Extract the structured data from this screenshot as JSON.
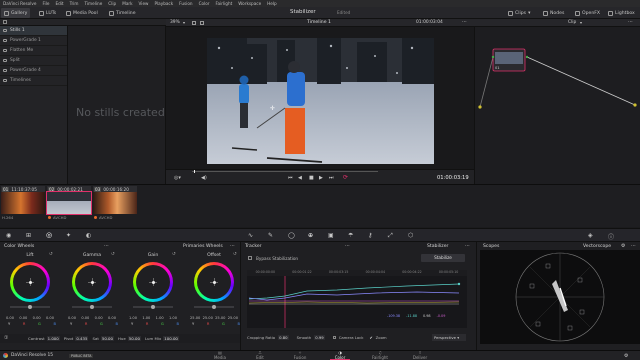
{
  "menu": {
    "items": [
      "DaVinci Resolve",
      "File",
      "Edit",
      "Trim",
      "Timeline",
      "Clip",
      "Mark",
      "View",
      "Playback",
      "Fusion",
      "Color",
      "Fairlight",
      "Workspace",
      "Help"
    ]
  },
  "toolbar": {
    "gallery": "Gallery",
    "luts": "LUTs",
    "media_pool": "Media Pool",
    "timeline": "Timeline",
    "project_title": "Stabilizer",
    "project_status": "Edited",
    "clips": "Clips",
    "nodes": "Nodes",
    "openfx": "OpenFX",
    "lightbox": "Lightbox"
  },
  "gallery": {
    "items": [
      "Stills 1",
      "PowerGrade 1",
      "Flatten Me",
      "Split",
      "PowerGrade 4",
      "Timelines"
    ],
    "empty_text": "No stills created"
  },
  "viewer": {
    "zoom": "39%",
    "timeline_name": "Timeline 1",
    "timecode_top": "01:00:03:04",
    "timecode": "01:00:03:19"
  },
  "node_panel": {
    "mode": "Clip",
    "node_label": "01"
  },
  "clips": [
    {
      "num": "01",
      "tc": "11:10:37:05",
      "codec": "H.264"
    },
    {
      "num": "02",
      "tc": "00:00:02:21",
      "codec": "AVCHD"
    },
    {
      "num": "03",
      "tc": "00:00:16:20",
      "codec": "AVCHD"
    }
  ],
  "wheels": {
    "title": "Color Wheels",
    "mode": "Primaries Wheels",
    "items": [
      {
        "name": "Lift",
        "values": [
          "0.00",
          "0.00",
          "0.00",
          "0.00"
        ]
      },
      {
        "name": "Gamma",
        "values": [
          "0.00",
          "0.00",
          "0.00",
          "0.00"
        ]
      },
      {
        "name": "Gain",
        "values": [
          "1.00",
          "1.00",
          "1.00",
          "1.00"
        ]
      },
      {
        "name": "Offset",
        "values": [
          "25.00",
          "25.00",
          "25.00",
          "25.00"
        ]
      }
    ],
    "keys": [
      "Y",
      "R",
      "G",
      "B"
    ],
    "key_colors": [
      "#dddddd",
      "#e84a4a",
      "#4ad84a",
      "#4a8ae8"
    ],
    "params": [
      {
        "label": "Contrast",
        "value": "1.000"
      },
      {
        "label": "Pivot",
        "value": "0.435"
      },
      {
        "label": "Sat",
        "value": "50.00"
      },
      {
        "label": "Hue",
        "value": "50.00"
      },
      {
        "label": "Lum Mix",
        "value": "100.00"
      }
    ]
  },
  "tracker": {
    "title": "Tracker",
    "mode": "Stabilizer",
    "bypass_label": "Bypass Stabilization",
    "stabilize_button": "Stabilize",
    "ruler": [
      "00:00:00:00",
      "00:00:01:22",
      "00:00:03:15",
      "00:00:04:04",
      "00:00:04:22",
      "00:00:05:10"
    ],
    "readouts": [
      "-109.38",
      "-11.88",
      "0.98",
      "-0.09"
    ],
    "readout_colors": [
      "#8a8aff",
      "#5ad0c8",
      "#d0d0d0",
      "#d060d0"
    ],
    "cropping_label": "Cropping Ratio",
    "cropping_value": "0.80",
    "smooth_label": "Smooth",
    "smooth_value": "0.99",
    "camera_lock_label": "Camera Lock",
    "zoom_label": "Zoom",
    "perspective_label": "Perspective"
  },
  "scopes": {
    "title": "Scopes",
    "type": "Vectorscope"
  },
  "status": {
    "app_name": "DaVinci Resolve 15",
    "badge": "PUBLIC BETA",
    "pages": [
      "Media",
      "Edit",
      "Fusion",
      "Color",
      "Fairlight",
      "Deliver"
    ],
    "active_page": "Color"
  }
}
